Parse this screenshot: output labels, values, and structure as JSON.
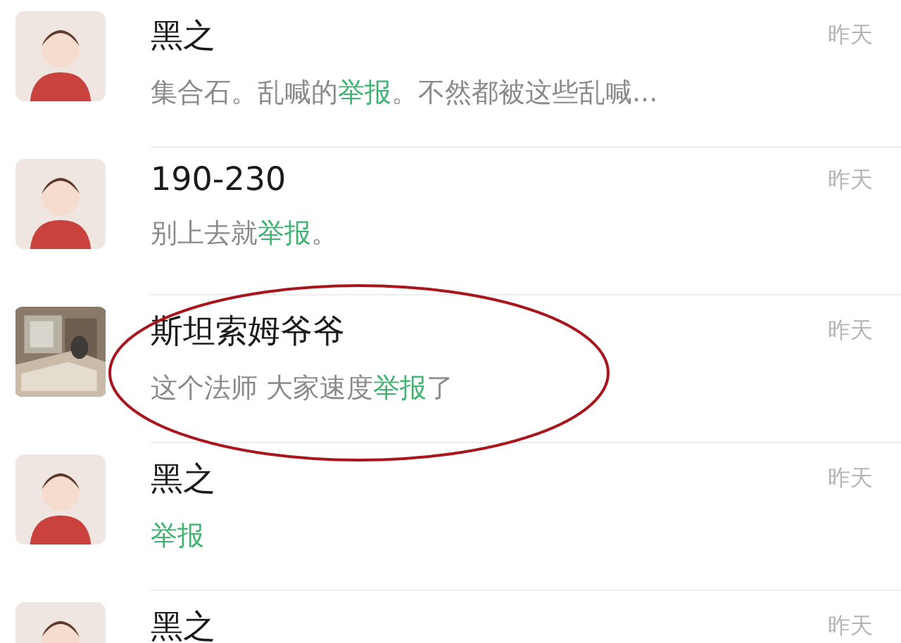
{
  "chats": [
    {
      "name": "黑之",
      "time": "昨天",
      "kind": "figure",
      "highlighted": false,
      "message": [
        {
          "text": "集合石。乱喊的",
          "keyword": false
        },
        {
          "text": "举报",
          "keyword": true
        },
        {
          "text": "。不然都被这些乱喊...",
          "keyword": false
        }
      ]
    },
    {
      "name": "190-230",
      "time": "昨天",
      "kind": "figure",
      "highlighted": false,
      "message": [
        {
          "text": "别上去就",
          "keyword": false
        },
        {
          "text": "举报",
          "keyword": true
        },
        {
          "text": "。",
          "keyword": false
        }
      ]
    },
    {
      "name": "斯坦索姆爷爷",
      "time": "昨天",
      "kind": "picture",
      "highlighted": true,
      "message": [
        {
          "text": "这个法师 大家速度",
          "keyword": false
        },
        {
          "text": "举报",
          "keyword": true
        },
        {
          "text": "了",
          "keyword": false
        }
      ]
    },
    {
      "name": "黑之",
      "time": "昨天",
      "kind": "figure",
      "highlighted": false,
      "message": [
        {
          "text": "举报",
          "keyword": true
        }
      ]
    },
    {
      "name": "黑之",
      "time": "昨天",
      "kind": "figure",
      "highlighted": false
    }
  ]
}
